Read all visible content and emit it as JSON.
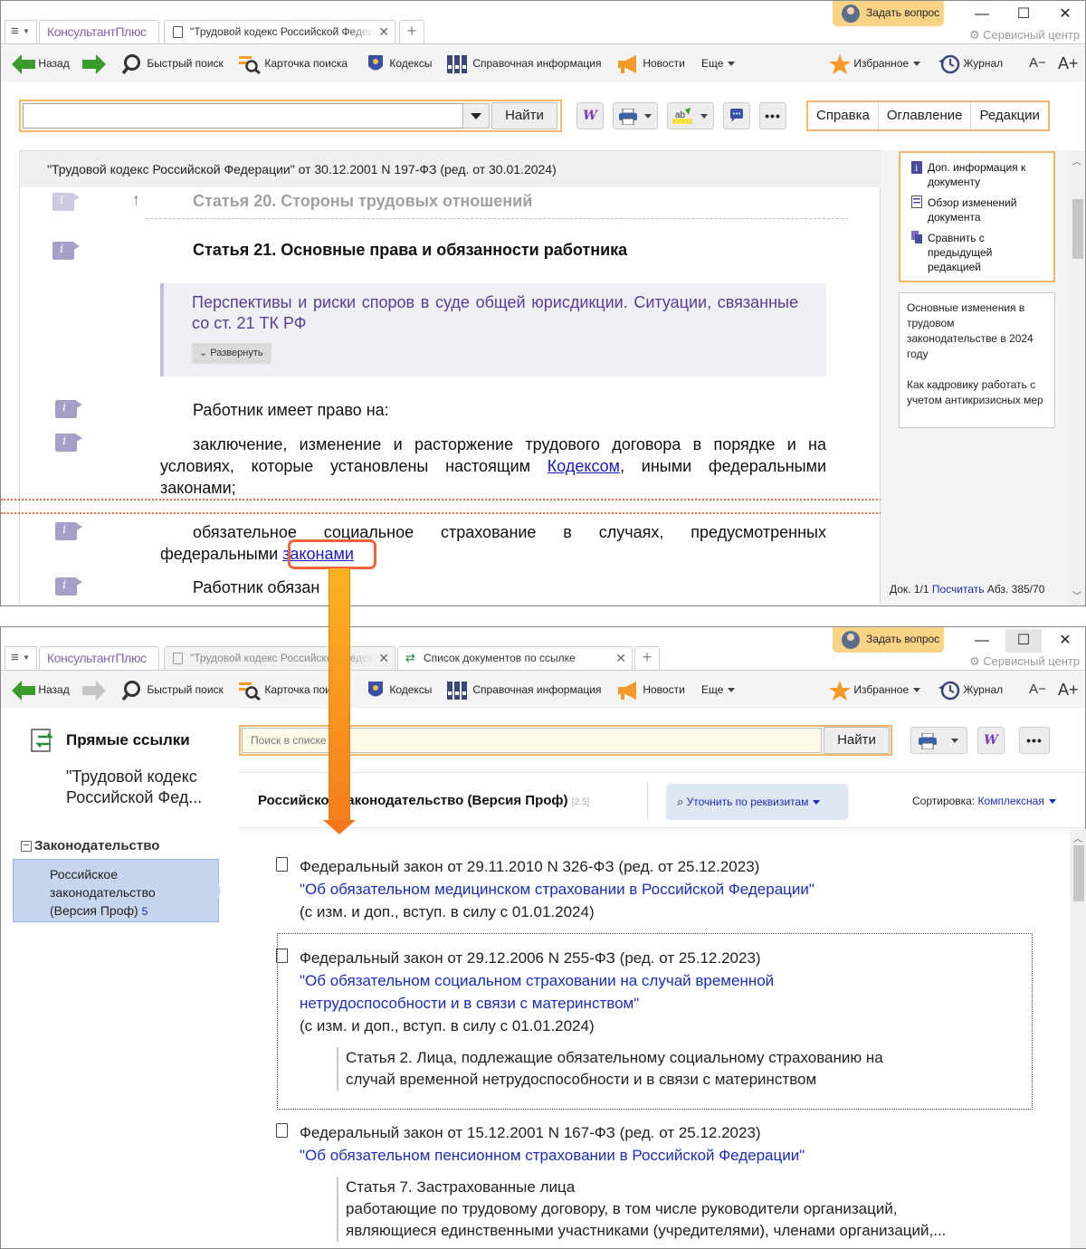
{
  "top_window": {
    "menu_label": "≡",
    "brand": "КонсультантПлюс",
    "tab_doc_title": "\"Трудовой кодекс Российской Федер",
    "ask_label": "Задать вопрос",
    "service_label": "Сервисный центр",
    "toolbar": {
      "back": "Назад",
      "quick_search": "Быстрый поиск",
      "search_card": "Карточка поиска",
      "codes": "Кодексы",
      "reference": "Справочная информация",
      "news": "Новости",
      "more": "Еще",
      "favorites": "Избранное",
      "journal": "Журнал",
      "font_minus": "A−",
      "font_plus": "A+"
    },
    "search": {
      "placeholder": "",
      "find_button": "Найти"
    },
    "right_tabs": [
      "Справка",
      "Оглавление",
      "Редакции"
    ],
    "doc_header": "\"Трудовой кодекс Российской Федерации\" от 30.12.2001 N 197-ФЗ (ред. от 30.01.2024)",
    "article20": "Статья 20. Стороны трудовых отношений",
    "article21": "Статья 21. Основные права и обязанности работника",
    "perspectives": "Перспективы и риски споров в суде общей юрисдикции. Ситуации, связанные со ст. 21 ТК РФ",
    "expand": "Развернуть",
    "p1": "Работник имеет право на:",
    "p2_line1": "заключение, изменение и расторжение трудового договора в порядке и на",
    "p2_line2_a": "условиях, которые установлены настоящим ",
    "p2_link": "Кодексом",
    "p2_line2_b": ", иными федеральными",
    "p2_line3": "законами;",
    "p3_line1": "обязательное социальное страхование в случаях, предусмотренных",
    "p3_line2_a": "федеральными ",
    "p3_link": "законами",
    "p4": "Работник обязан",
    "info_items": [
      "Доп. информация к документу",
      "Обзор изменений документа",
      "Сравнить с предыдущей редакцией"
    ],
    "news_items": [
      "Основные изменения в трудовом законодательстве в 2024 году",
      "Как кадровику работать с учетом антикризисных мер"
    ],
    "status": {
      "doc": "Док. 1/1",
      "count": "Посчитать",
      "abs": "Абз. 385/70"
    }
  },
  "bottom_window": {
    "tab1": "\"Трудовой кодекс Российской Федер",
    "tab2": "Список документов по ссылке",
    "direct_links": "Прямые ссылки",
    "source_doc": "\"Трудовой кодекс Российской Фед...",
    "tree_header": "Законодательство",
    "tree_item": "Российское законодательство (Версия Проф)",
    "tree_count": "5",
    "search_placeholder": "Поиск в списке",
    "find_button": "Найти",
    "result_title": "Российское законодательство (Версия Проф)",
    "result_range": "[2:5]",
    "refine": "Уточнить по реквизитам",
    "sort_label": "Сортировка:",
    "sort_value": "Комплексная",
    "results": [
      {
        "head": "Федеральный закон от 29.11.2010 N 326-ФЗ (ред. от 25.12.2023)",
        "title": "\"Об обязательном медицинском страховании в Российской Федерации\"",
        "note": "(с изм. и доп., вступ. в силу с 01.01.2024)"
      },
      {
        "head": "Федеральный закон от 29.12.2006 N 255-ФЗ (ред. от 25.12.2023)",
        "title1": "\"Об обязательном социальном страховании на случай временной",
        "title2": "нетрудоспособности и в связи с материнством\"",
        "note": "(с изм. и доп., вступ. в силу с 01.01.2024)",
        "quote1": "Статья 2. Лица, подлежащие обязательному социальному страхованию на",
        "quote2": "случай временной нетрудоспособности и в связи с материнством"
      },
      {
        "head": "Федеральный закон от 15.12.2001 N 167-ФЗ (ред. от 25.12.2023)",
        "title": "\"Об обязательном пенсионном страховании в Российской Федерации\"",
        "quote1": "Статья 7. Застрахованные лица",
        "quote2": "работающие по трудовому договору, в том числе руководители организаций,",
        "quote3": "являющиеся единственными участниками (учредителями), членами организаций,..."
      }
    ]
  },
  "colors": {
    "brand": "#8560a8",
    "accent_border": "#f5b86a",
    "link": "#1a2dbf",
    "highlight": "#f2623a",
    "arrow": "#fdb322"
  }
}
